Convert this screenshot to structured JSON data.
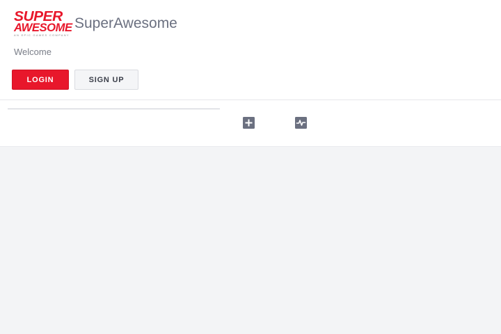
{
  "brand": {
    "logo_line1": "SUPER",
    "logo_line2": "AWESOME",
    "logo_tagline": "AN EPIC GAMES COMPANY",
    "logo_color": "#e8172b",
    "app_name": "SuperAwesome"
  },
  "header": {
    "welcome_text": "Welcome",
    "login_label": "LOGIN",
    "signup_label": "SIGN UP"
  },
  "toolbar": {
    "icons": [
      "add-square-icon",
      "activity-square-icon"
    ]
  },
  "colors": {
    "accent": "#e8172b",
    "page_background": "#f3f4f6",
    "icon": "#6b7080"
  }
}
